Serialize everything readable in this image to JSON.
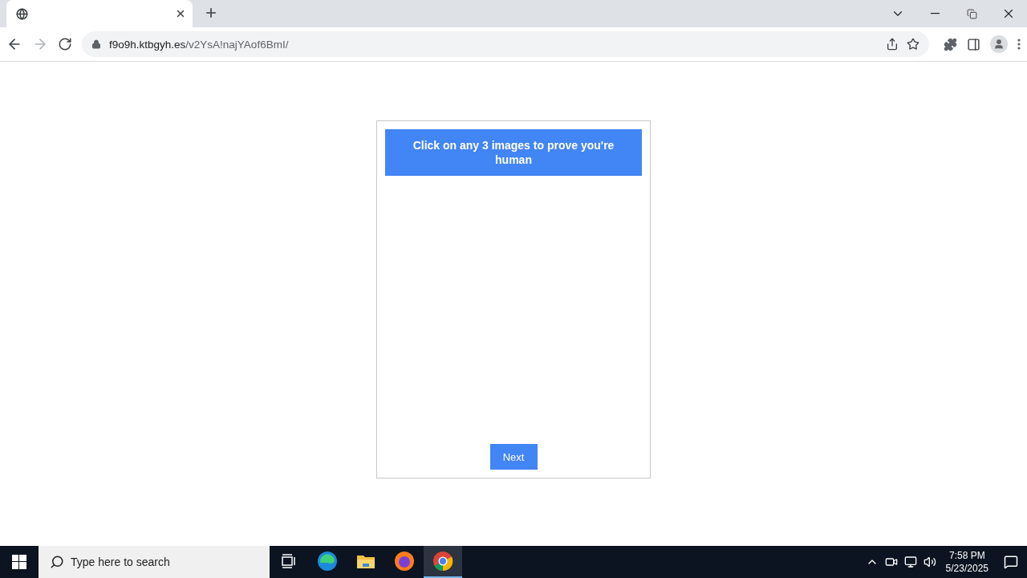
{
  "browser": {
    "tabs": [
      {
        "selected": true
      }
    ],
    "url": {
      "host": "f9o9h.ktbgyh.es",
      "path": "/v2YsA!najYAof6BmI/"
    }
  },
  "captcha": {
    "heading": "Click on any 3 images to prove you're human",
    "button": "Next"
  },
  "taskbar": {
    "search": {
      "placeholder": "Type here to search"
    },
    "apps": [
      {
        "kind": "taskview",
        "selected": false
      },
      {
        "kind": "edge",
        "selected": false
      },
      {
        "kind": "files",
        "selected": false
      },
      {
        "kind": "firefox",
        "selected": false
      },
      {
        "kind": "chrome",
        "selected": true
      }
    ],
    "time": "7:58 PM",
    "date": "5/23/2025"
  }
}
